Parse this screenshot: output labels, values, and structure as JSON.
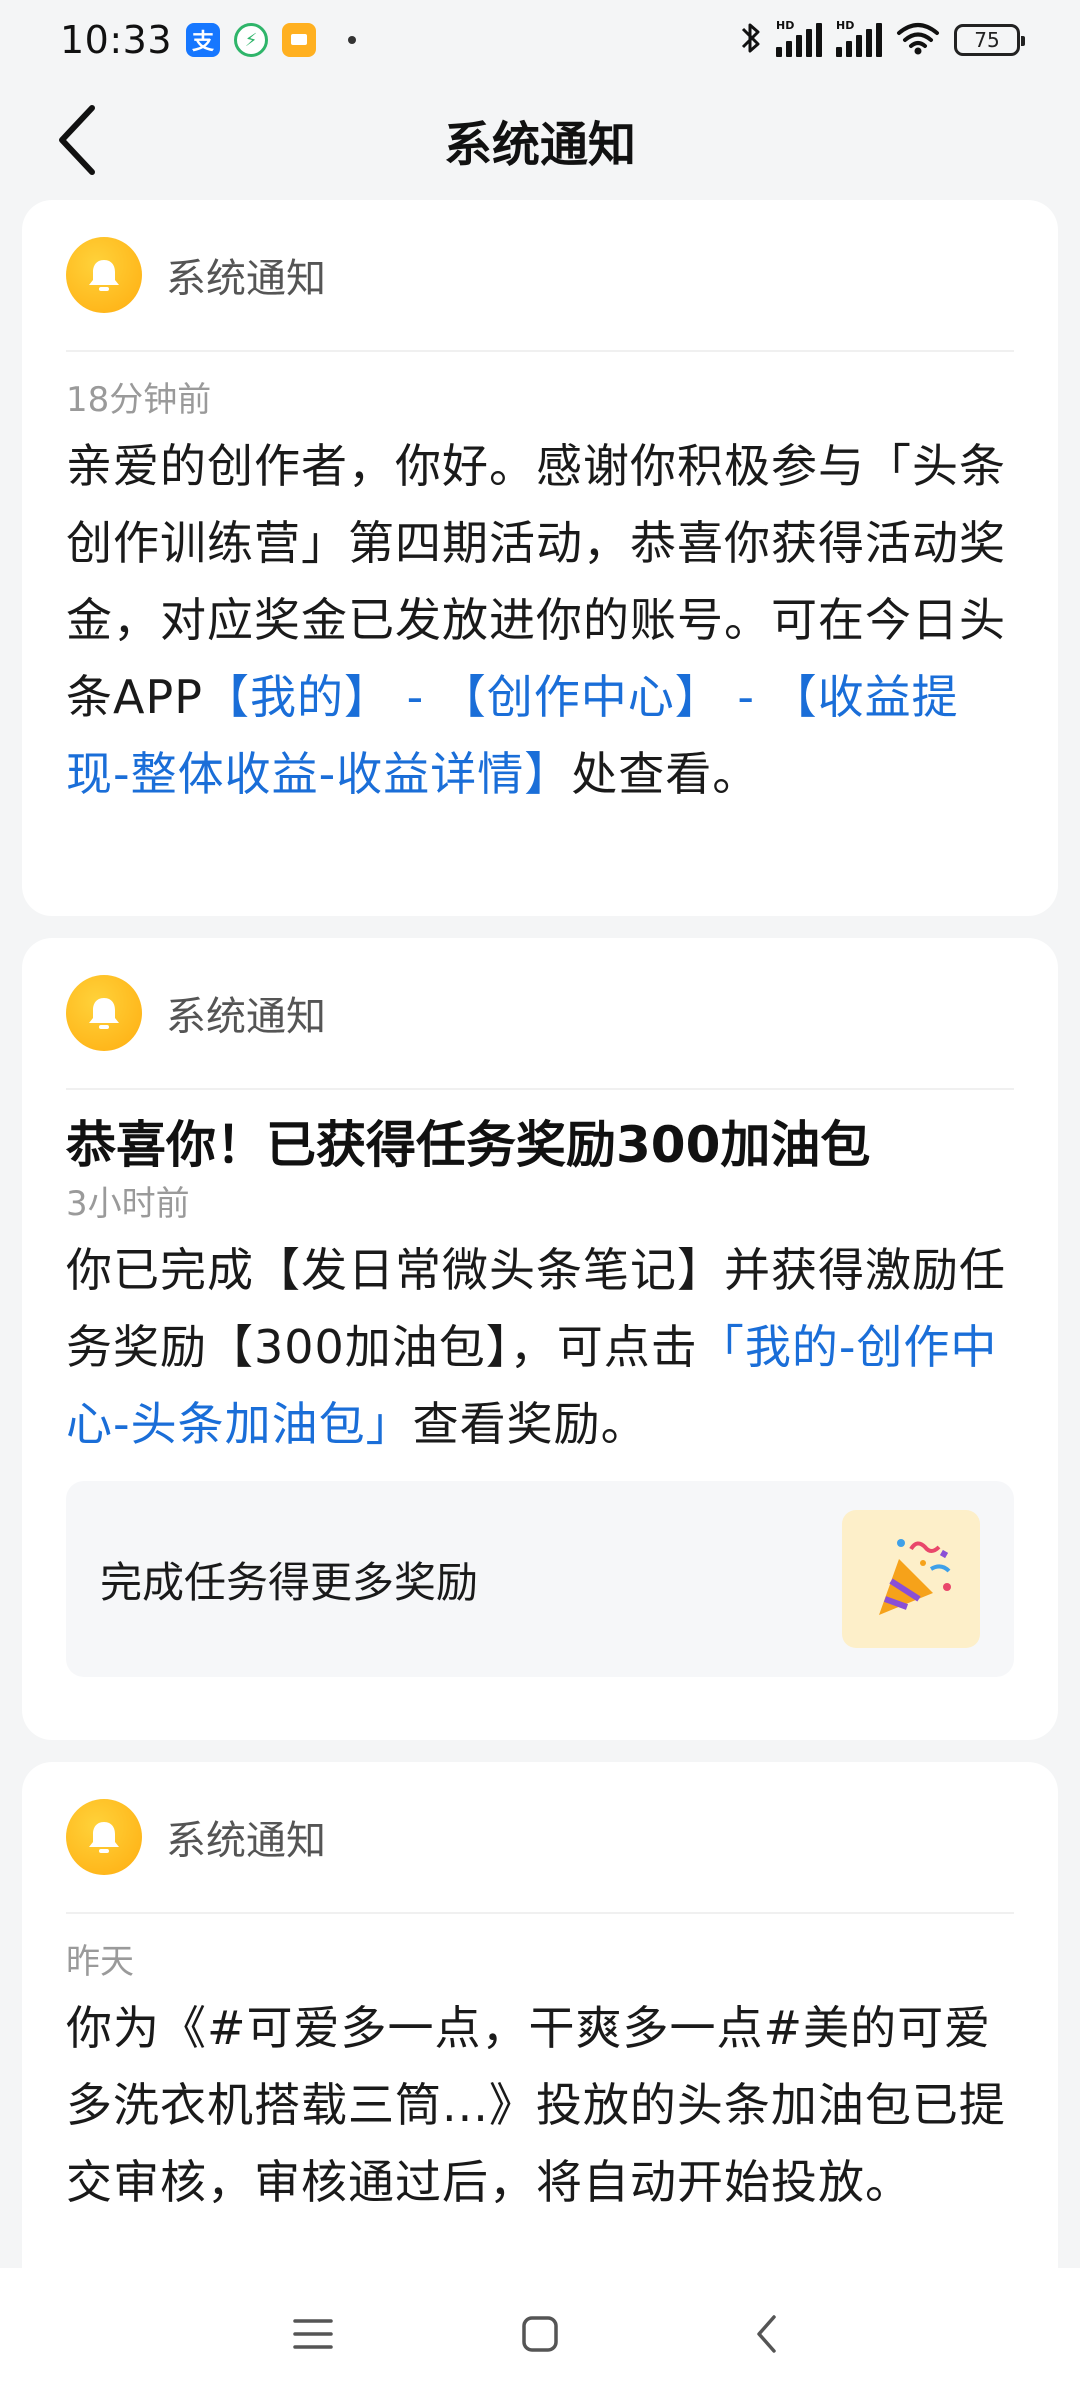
{
  "status_bar": {
    "time": "10:33",
    "app_alipay": "支",
    "battery": "75"
  },
  "header": {
    "title": "系统通知"
  },
  "notifications": [
    {
      "source": "系统通知",
      "time": "18分钟前",
      "body_plain_1": "亲爱的创作者，你好。感谢你积极参与「头条创作训练营」第四期活动，恭喜你获得活动奖金，对应奖金已发放进你的账号。可在今日头条APP",
      "link": "【我的】 - 【创作中心】 - 【收益提现-整体收益-收益详情】",
      "body_plain_2": "处查看。"
    },
    {
      "source": "系统通知",
      "title": "恭喜你！已获得任务奖励300加油包",
      "time": "3小时前",
      "body_plain_1": "你已完成【发日常微头条笔记】并获得激励任务奖励【300加油包】，可点击",
      "link": "「我的-创作中心-头条加油包」",
      "body_plain_2": "查看奖励。",
      "promo_text": "完成任务得更多奖励"
    },
    {
      "source": "系统通知",
      "time": "昨天",
      "body_plain_1": "你为《#可爱多一点，干爽多一点#美的可爱多洗衣机搭载三筒...》投放的头条加油包已提交审核，审核通过后，将自动开始投放。"
    }
  ]
}
